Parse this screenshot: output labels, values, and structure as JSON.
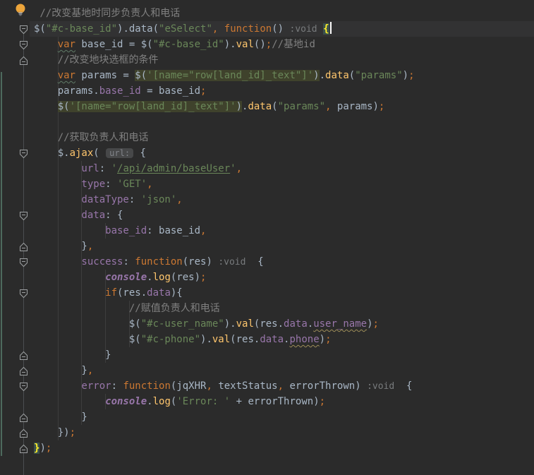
{
  "app": {
    "kind": "code-editor",
    "theme": "darcula"
  },
  "colors": {
    "background": "#2b2b2b",
    "caret_line": "#323233",
    "default_text": "#a9b7c6",
    "keyword": "#cc7832",
    "string": "#6a8759",
    "method": "#ffc66d",
    "field": "#9876aa",
    "comment": "#808080",
    "identifier_highlight": "#3f422c",
    "matched_brace_bg": "#3b514d",
    "matched_brace_text": "#ffef28",
    "vcs_change_bar": "#4d6a5d",
    "fold_marker": "#9da0a2",
    "bulb": "#eda53b"
  },
  "gutter": {
    "bulb_line": 1,
    "vcs_bar": {
      "from_line": 5,
      "to_line": 29
    },
    "fold_markers": [
      {
        "line": 2,
        "dir": "down"
      },
      {
        "line": 3,
        "dir": "down"
      },
      {
        "line": 4,
        "dir": "up"
      },
      {
        "line": 10,
        "dir": "down"
      },
      {
        "line": 14,
        "dir": "down"
      },
      {
        "line": 16,
        "dir": "up"
      },
      {
        "line": 17,
        "dir": "down"
      },
      {
        "line": 19,
        "dir": "down"
      },
      {
        "line": 23,
        "dir": "up"
      },
      {
        "line": 24,
        "dir": "up"
      },
      {
        "line": 25,
        "dir": "down"
      },
      {
        "line": 27,
        "dir": "up"
      },
      {
        "line": 28,
        "dir": "up"
      },
      {
        "line": 29,
        "dir": "up"
      }
    ]
  },
  "editor": {
    "caret_line": 2,
    "indent_guides": [
      {
        "col": 4,
        "from": 3,
        "to": 28
      },
      {
        "col": 8,
        "from": 11,
        "to": 27
      },
      {
        "col": 12,
        "from": 15,
        "to": 15
      },
      {
        "col": 12,
        "from": 18,
        "to": 23
      },
      {
        "col": 12,
        "from": 26,
        "to": 26
      },
      {
        "col": 16,
        "from": 20,
        "to": 22
      }
    ],
    "lines": [
      {
        "indent": 1,
        "tokens": [
          {
            "c": "cmt",
            "t": "//改变基地时同步负责人和电话"
          }
        ]
      },
      {
        "indent": 0,
        "tokens": [
          {
            "c": "df",
            "t": "$("
          },
          {
            "c": "str",
            "t": "\"#c-base_id\""
          },
          {
            "c": "df",
            "t": ").data("
          },
          {
            "c": "str",
            "t": "\"eSelect\""
          },
          {
            "c": "sc",
            "t": ","
          },
          {
            "c": "df",
            "t": " "
          },
          {
            "c": "kw",
            "t": "function"
          },
          {
            "c": "df",
            "t": "() "
          },
          {
            "c": "hint",
            "t": ":void"
          },
          {
            "c": "df",
            "t": " "
          },
          {
            "c": "brace",
            "t": "{"
          },
          {
            "c": "caret",
            "t": ""
          }
        ]
      },
      {
        "indent": 4,
        "tokens": [
          {
            "c": "kwsq",
            "t": "var"
          },
          {
            "c": "df",
            "t": " base_id = $("
          },
          {
            "c": "str",
            "t": "\"#c-base_id\""
          },
          {
            "c": "df",
            "t": ")."
          },
          {
            "c": "mth",
            "t": "val"
          },
          {
            "c": "df",
            "t": "()"
          },
          {
            "c": "sc",
            "t": ";"
          },
          {
            "c": "cmt",
            "t": "//基地id"
          }
        ]
      },
      {
        "indent": 4,
        "tokens": [
          {
            "c": "cmt",
            "t": "//改变地块选框的条件"
          }
        ]
      },
      {
        "indent": 4,
        "tokens": [
          {
            "c": "kwsq",
            "t": "var"
          },
          {
            "c": "df",
            "t": " params = "
          },
          {
            "c": "df",
            "t": "$(",
            "h": 1
          },
          {
            "c": "str",
            "t": "'[name=\"row[land_id]_text\"]'",
            "h": 1
          },
          {
            "c": "df",
            "t": ")",
            "h": 1
          },
          {
            "c": "df",
            "t": "."
          },
          {
            "c": "mth",
            "t": "data"
          },
          {
            "c": "df",
            "t": "("
          },
          {
            "c": "str",
            "t": "\"params\""
          },
          {
            "c": "df",
            "t": ")"
          },
          {
            "c": "sc",
            "t": ";"
          }
        ]
      },
      {
        "indent": 4,
        "tokens": [
          {
            "c": "df",
            "t": "params."
          },
          {
            "c": "fld",
            "t": "base_id"
          },
          {
            "c": "df",
            "t": " = base_id"
          },
          {
            "c": "sc",
            "t": ";"
          }
        ]
      },
      {
        "indent": 4,
        "tokens": [
          {
            "c": "df",
            "t": "$(",
            "h": 1
          },
          {
            "c": "str",
            "t": "'[name=\"row[land_id]_text\"]'",
            "h": 1
          },
          {
            "c": "df",
            "t": ")",
            "h": 1
          },
          {
            "c": "df",
            "t": "."
          },
          {
            "c": "mth",
            "t": "data"
          },
          {
            "c": "df",
            "t": "("
          },
          {
            "c": "str",
            "t": "\"params\""
          },
          {
            "c": "sc",
            "t": ","
          },
          {
            "c": "df",
            "t": " params)"
          },
          {
            "c": "sc",
            "t": ";"
          }
        ]
      },
      {
        "indent": 0,
        "tokens": []
      },
      {
        "indent": 4,
        "tokens": [
          {
            "c": "cmt",
            "t": "//获取负责人和电话"
          }
        ]
      },
      {
        "indent": 4,
        "tokens": [
          {
            "c": "df",
            "t": "$."
          },
          {
            "c": "mth",
            "t": "ajax"
          },
          {
            "c": "df",
            "t": "( "
          },
          {
            "c": "chip",
            "t": "url:"
          },
          {
            "c": "df",
            "t": " {"
          }
        ]
      },
      {
        "indent": 8,
        "tokens": [
          {
            "c": "fld",
            "t": "url"
          },
          {
            "c": "df",
            "t": ": "
          },
          {
            "c": "str",
            "t": "'"
          },
          {
            "c": "strlink",
            "t": "/api/admin/baseUser"
          },
          {
            "c": "str",
            "t": "'"
          },
          {
            "c": "sc",
            "t": ","
          }
        ]
      },
      {
        "indent": 8,
        "tokens": [
          {
            "c": "fld",
            "t": "type"
          },
          {
            "c": "df",
            "t": ": "
          },
          {
            "c": "str",
            "t": "'GET'"
          },
          {
            "c": "sc",
            "t": ","
          }
        ]
      },
      {
        "indent": 8,
        "tokens": [
          {
            "c": "fld",
            "t": "dataType"
          },
          {
            "c": "df",
            "t": ": "
          },
          {
            "c": "str",
            "t": "'json'"
          },
          {
            "c": "sc",
            "t": ","
          }
        ]
      },
      {
        "indent": 8,
        "tokens": [
          {
            "c": "fld",
            "t": "data"
          },
          {
            "c": "df",
            "t": ": {"
          }
        ]
      },
      {
        "indent": 12,
        "tokens": [
          {
            "c": "fld",
            "t": "base_id"
          },
          {
            "c": "df",
            "t": ": base_id"
          },
          {
            "c": "sc",
            "t": ","
          }
        ]
      },
      {
        "indent": 8,
        "tokens": [
          {
            "c": "df",
            "t": "}"
          },
          {
            "c": "sc",
            "t": ","
          }
        ]
      },
      {
        "indent": 8,
        "tokens": [
          {
            "c": "fld",
            "t": "success"
          },
          {
            "c": "df",
            "t": ": "
          },
          {
            "c": "kw",
            "t": "function"
          },
          {
            "c": "df",
            "t": "(res) "
          },
          {
            "c": "hint",
            "t": ":void"
          },
          {
            "c": "df",
            "t": "  {"
          }
        ]
      },
      {
        "indent": 12,
        "tokens": [
          {
            "c": "glob",
            "t": "console"
          },
          {
            "c": "df",
            "t": "."
          },
          {
            "c": "mth",
            "t": "log"
          },
          {
            "c": "df",
            "t": "(res)"
          },
          {
            "c": "sc",
            "t": ";"
          }
        ]
      },
      {
        "indent": 12,
        "tokens": [
          {
            "c": "kw",
            "t": "if"
          },
          {
            "c": "df",
            "t": "(res."
          },
          {
            "c": "fld",
            "t": "data"
          },
          {
            "c": "df",
            "t": "){"
          }
        ]
      },
      {
        "indent": 16,
        "tokens": [
          {
            "c": "cmt",
            "t": "//赋值负责人和电话"
          }
        ]
      },
      {
        "indent": 16,
        "tokens": [
          {
            "c": "df",
            "t": "$("
          },
          {
            "c": "str",
            "t": "\"#c-user_name\""
          },
          {
            "c": "df",
            "t": ")."
          },
          {
            "c": "mth",
            "t": "val"
          },
          {
            "c": "df",
            "t": "(res."
          },
          {
            "c": "fld",
            "t": "data"
          },
          {
            "c": "df",
            "t": "."
          },
          {
            "c": "fldsq",
            "t": "user_name"
          },
          {
            "c": "df",
            "t": ")"
          },
          {
            "c": "sc",
            "t": ";"
          }
        ]
      },
      {
        "indent": 16,
        "tokens": [
          {
            "c": "df",
            "t": "$("
          },
          {
            "c": "str",
            "t": "\"#c-phone\""
          },
          {
            "c": "df",
            "t": ")."
          },
          {
            "c": "mth",
            "t": "val"
          },
          {
            "c": "df",
            "t": "(res."
          },
          {
            "c": "fld",
            "t": "data"
          },
          {
            "c": "df",
            "t": "."
          },
          {
            "c": "fldsq",
            "t": "phone"
          },
          {
            "c": "df",
            "t": ")"
          },
          {
            "c": "sc",
            "t": ";"
          }
        ]
      },
      {
        "indent": 12,
        "tokens": [
          {
            "c": "df",
            "t": "}"
          }
        ]
      },
      {
        "indent": 8,
        "tokens": [
          {
            "c": "df",
            "t": "}"
          },
          {
            "c": "sc",
            "t": ","
          }
        ]
      },
      {
        "indent": 8,
        "tokens": [
          {
            "c": "fld",
            "t": "error"
          },
          {
            "c": "df",
            "t": ": "
          },
          {
            "c": "kw",
            "t": "function"
          },
          {
            "c": "df",
            "t": "(jqXHR"
          },
          {
            "c": "sc",
            "t": ","
          },
          {
            "c": "df",
            "t": " textStatus"
          },
          {
            "c": "sc",
            "t": ","
          },
          {
            "c": "df",
            "t": " errorThrown) "
          },
          {
            "c": "hint",
            "t": ":void"
          },
          {
            "c": "df",
            "t": "  {"
          }
        ]
      },
      {
        "indent": 12,
        "tokens": [
          {
            "c": "glob",
            "t": "console"
          },
          {
            "c": "df",
            "t": "."
          },
          {
            "c": "mth",
            "t": "log"
          },
          {
            "c": "df",
            "t": "("
          },
          {
            "c": "str",
            "t": "'Error: '"
          },
          {
            "c": "df",
            "t": " + errorThrown)"
          },
          {
            "c": "sc",
            "t": ";"
          }
        ]
      },
      {
        "indent": 8,
        "tokens": [
          {
            "c": "df",
            "t": "}"
          }
        ]
      },
      {
        "indent": 4,
        "tokens": [
          {
            "c": "df",
            "t": "})"
          },
          {
            "c": "sc",
            "t": ";"
          }
        ]
      },
      {
        "indent": 0,
        "tokens": [
          {
            "c": "brace",
            "t": "}"
          },
          {
            "c": "df",
            "t": ")"
          },
          {
            "c": "sc",
            "t": ";"
          }
        ]
      }
    ]
  }
}
